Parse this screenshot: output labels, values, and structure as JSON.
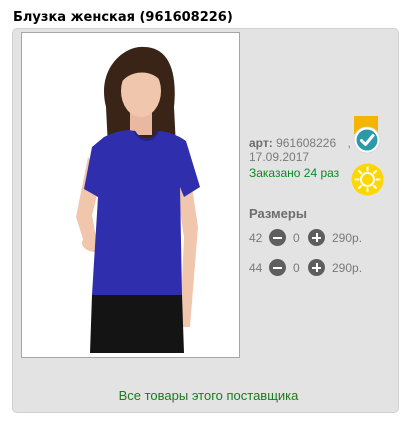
{
  "product": {
    "title": "Блузка женская (961608226)",
    "art_label": "арт:",
    "art_number": "961608226",
    "separator": ",",
    "date": "17.09.2017",
    "ordered": "Заказано 24 раз"
  },
  "sizes": {
    "heading": "Размеры",
    "rows": [
      {
        "size": "42",
        "qty": "0",
        "price": "290р."
      },
      {
        "size": "44",
        "qty": "0",
        "price": "290р."
      }
    ]
  },
  "supplier_link": "Все товары этого поставщика",
  "icons": {
    "status": "check-badge-icon",
    "popularity": "sun-icon",
    "decrease": "minus-circle-icon",
    "increase": "plus-circle-icon"
  },
  "colors": {
    "blouse": "#2f2fae",
    "link": "#1c7a1c",
    "ordered": "#0a8a23",
    "badge_orange": "#f5b400",
    "badge_teal": "#2a9aa8",
    "sun_yellow": "#ffd700"
  }
}
